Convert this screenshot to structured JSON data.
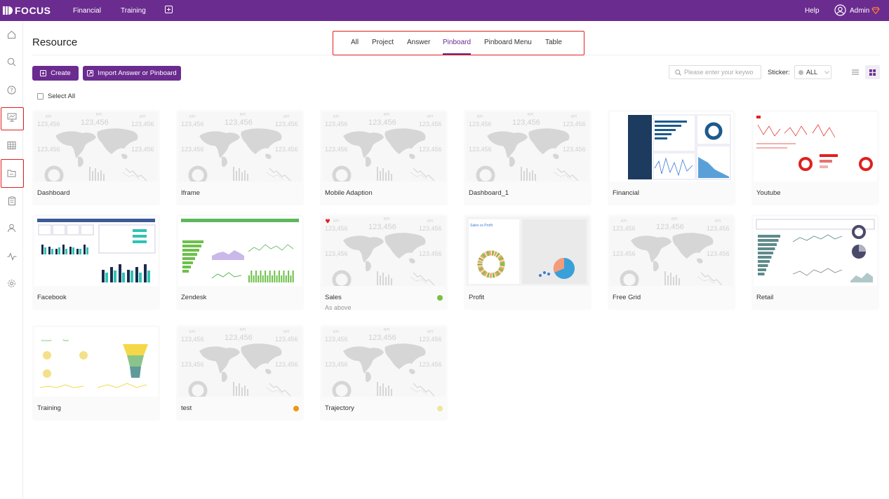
{
  "header": {
    "logo_text": "FOCUS",
    "nav": [
      "Financial",
      "Training"
    ],
    "add_icon": "plus-square-icon",
    "help": "Help",
    "user": "Admin"
  },
  "sidebar": {
    "icons": [
      "home-icon",
      "search-icon",
      "help-icon",
      "pinboard-icon",
      "table-icon",
      "folder-icon",
      "clipboard-icon",
      "user-icon",
      "activity-icon",
      "settings-icon"
    ],
    "highlighted": [
      "pinboard-icon",
      "folder-icon"
    ]
  },
  "page": {
    "title": "Resource"
  },
  "tabs": [
    {
      "label": "All"
    },
    {
      "label": "Project"
    },
    {
      "label": "Answer"
    },
    {
      "label": "Pinboard",
      "active": true
    },
    {
      "label": "Pinboard Menu"
    },
    {
      "label": "Table"
    }
  ],
  "toolbar": {
    "create_label": "Create",
    "import_label": "Import Answer or Pinboard",
    "search_placeholder": "Please enter your keywo",
    "sticker_label": "Sticker:",
    "sticker_value": "ALL",
    "select_all": "Select All"
  },
  "placeholder_number": "123,456",
  "placeholder_kpi": "KPI",
  "cards": [
    {
      "name": "Dashboard",
      "thumb": "placeholder"
    },
    {
      "name": "Iframe",
      "thumb": "placeholder"
    },
    {
      "name": "Mobile Adaption",
      "thumb": "placeholder"
    },
    {
      "name": "Dashboard_1",
      "thumb": "placeholder"
    },
    {
      "name": "Financial",
      "thumb": "financial"
    },
    {
      "name": "Youtube",
      "thumb": "youtube"
    },
    {
      "name": "Facebook",
      "thumb": "facebook"
    },
    {
      "name": "Zendesk",
      "thumb": "zendesk"
    },
    {
      "name": "Sales",
      "thumb": "placeholder",
      "sub": "As above",
      "sticker": "#7ac143",
      "heart": true
    },
    {
      "name": "Profit",
      "thumb": "profit"
    },
    {
      "name": "Free Grid",
      "thumb": "placeholder"
    },
    {
      "name": "Retail",
      "thumb": "retail"
    },
    {
      "name": "Training",
      "thumb": "training"
    },
    {
      "name": "test",
      "thumb": "placeholder",
      "sticker": "#f0960f"
    },
    {
      "name": "Trajectory",
      "thumb": "placeholder",
      "sticker": "#ede6a0"
    }
  ],
  "colors": {
    "brand": "#6b2c8f",
    "highlight_border": "#e02020"
  }
}
